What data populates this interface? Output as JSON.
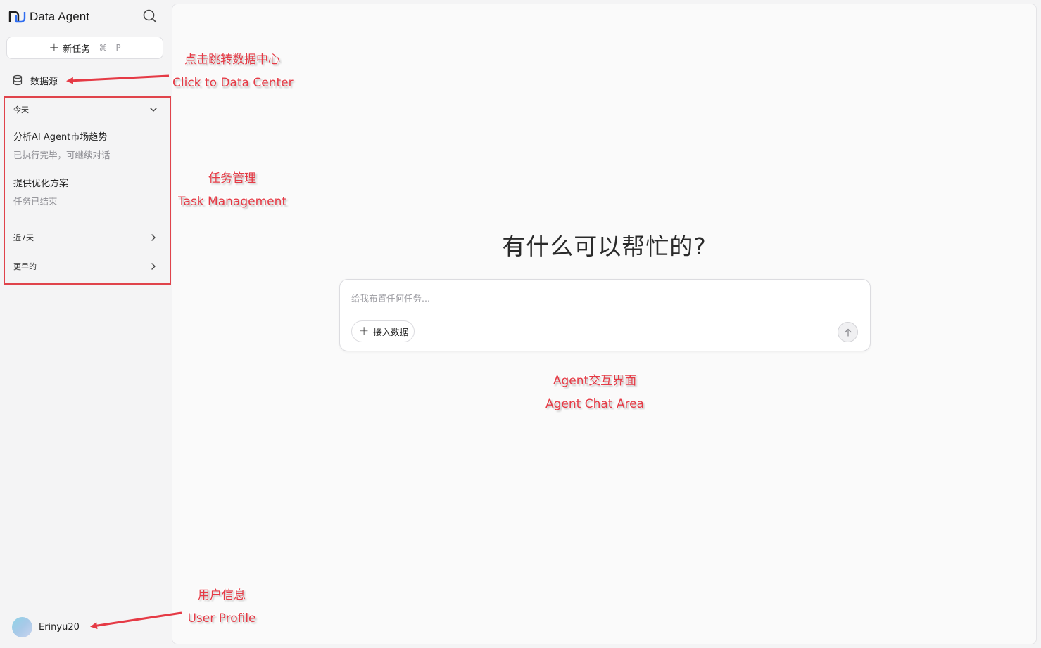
{
  "sidebar": {
    "brand": "Data Agent",
    "new_task": {
      "label": "新任务",
      "shortcut_key1": "⌘",
      "shortcut_key2": "P"
    },
    "datasource_label": "数据源",
    "groups": {
      "today": "今天",
      "last7": "近7天",
      "earlier": "更早的"
    },
    "tasks": [
      {
        "title": "分析AI Agent市场趋势",
        "status": "已执行完毕，可继续对话"
      },
      {
        "title": "提供优化方案",
        "status": "任务已结束"
      }
    ],
    "user": {
      "name": "Erinyu20"
    }
  },
  "main": {
    "headline": "有什么可以帮忙的?",
    "composer": {
      "placeholder": "给我布置任何任务...",
      "connect_label": "接入数据"
    }
  },
  "annotations": {
    "datacenter_cn": "点击跳转数据中心",
    "datacenter_en": "Click to Data Center",
    "task_cn": "任务管理",
    "task_en": "Task Management",
    "chat_cn": "Agent交互界面",
    "chat_en": "Agent Chat Area",
    "user_cn": "用户信息",
    "user_en": "User Profile"
  },
  "colors": {
    "annotation": "#e53a45",
    "sidebar_bg": "#f4f4f5",
    "main_bg": "#fafafa",
    "brand_blue": "#2f6df0"
  }
}
